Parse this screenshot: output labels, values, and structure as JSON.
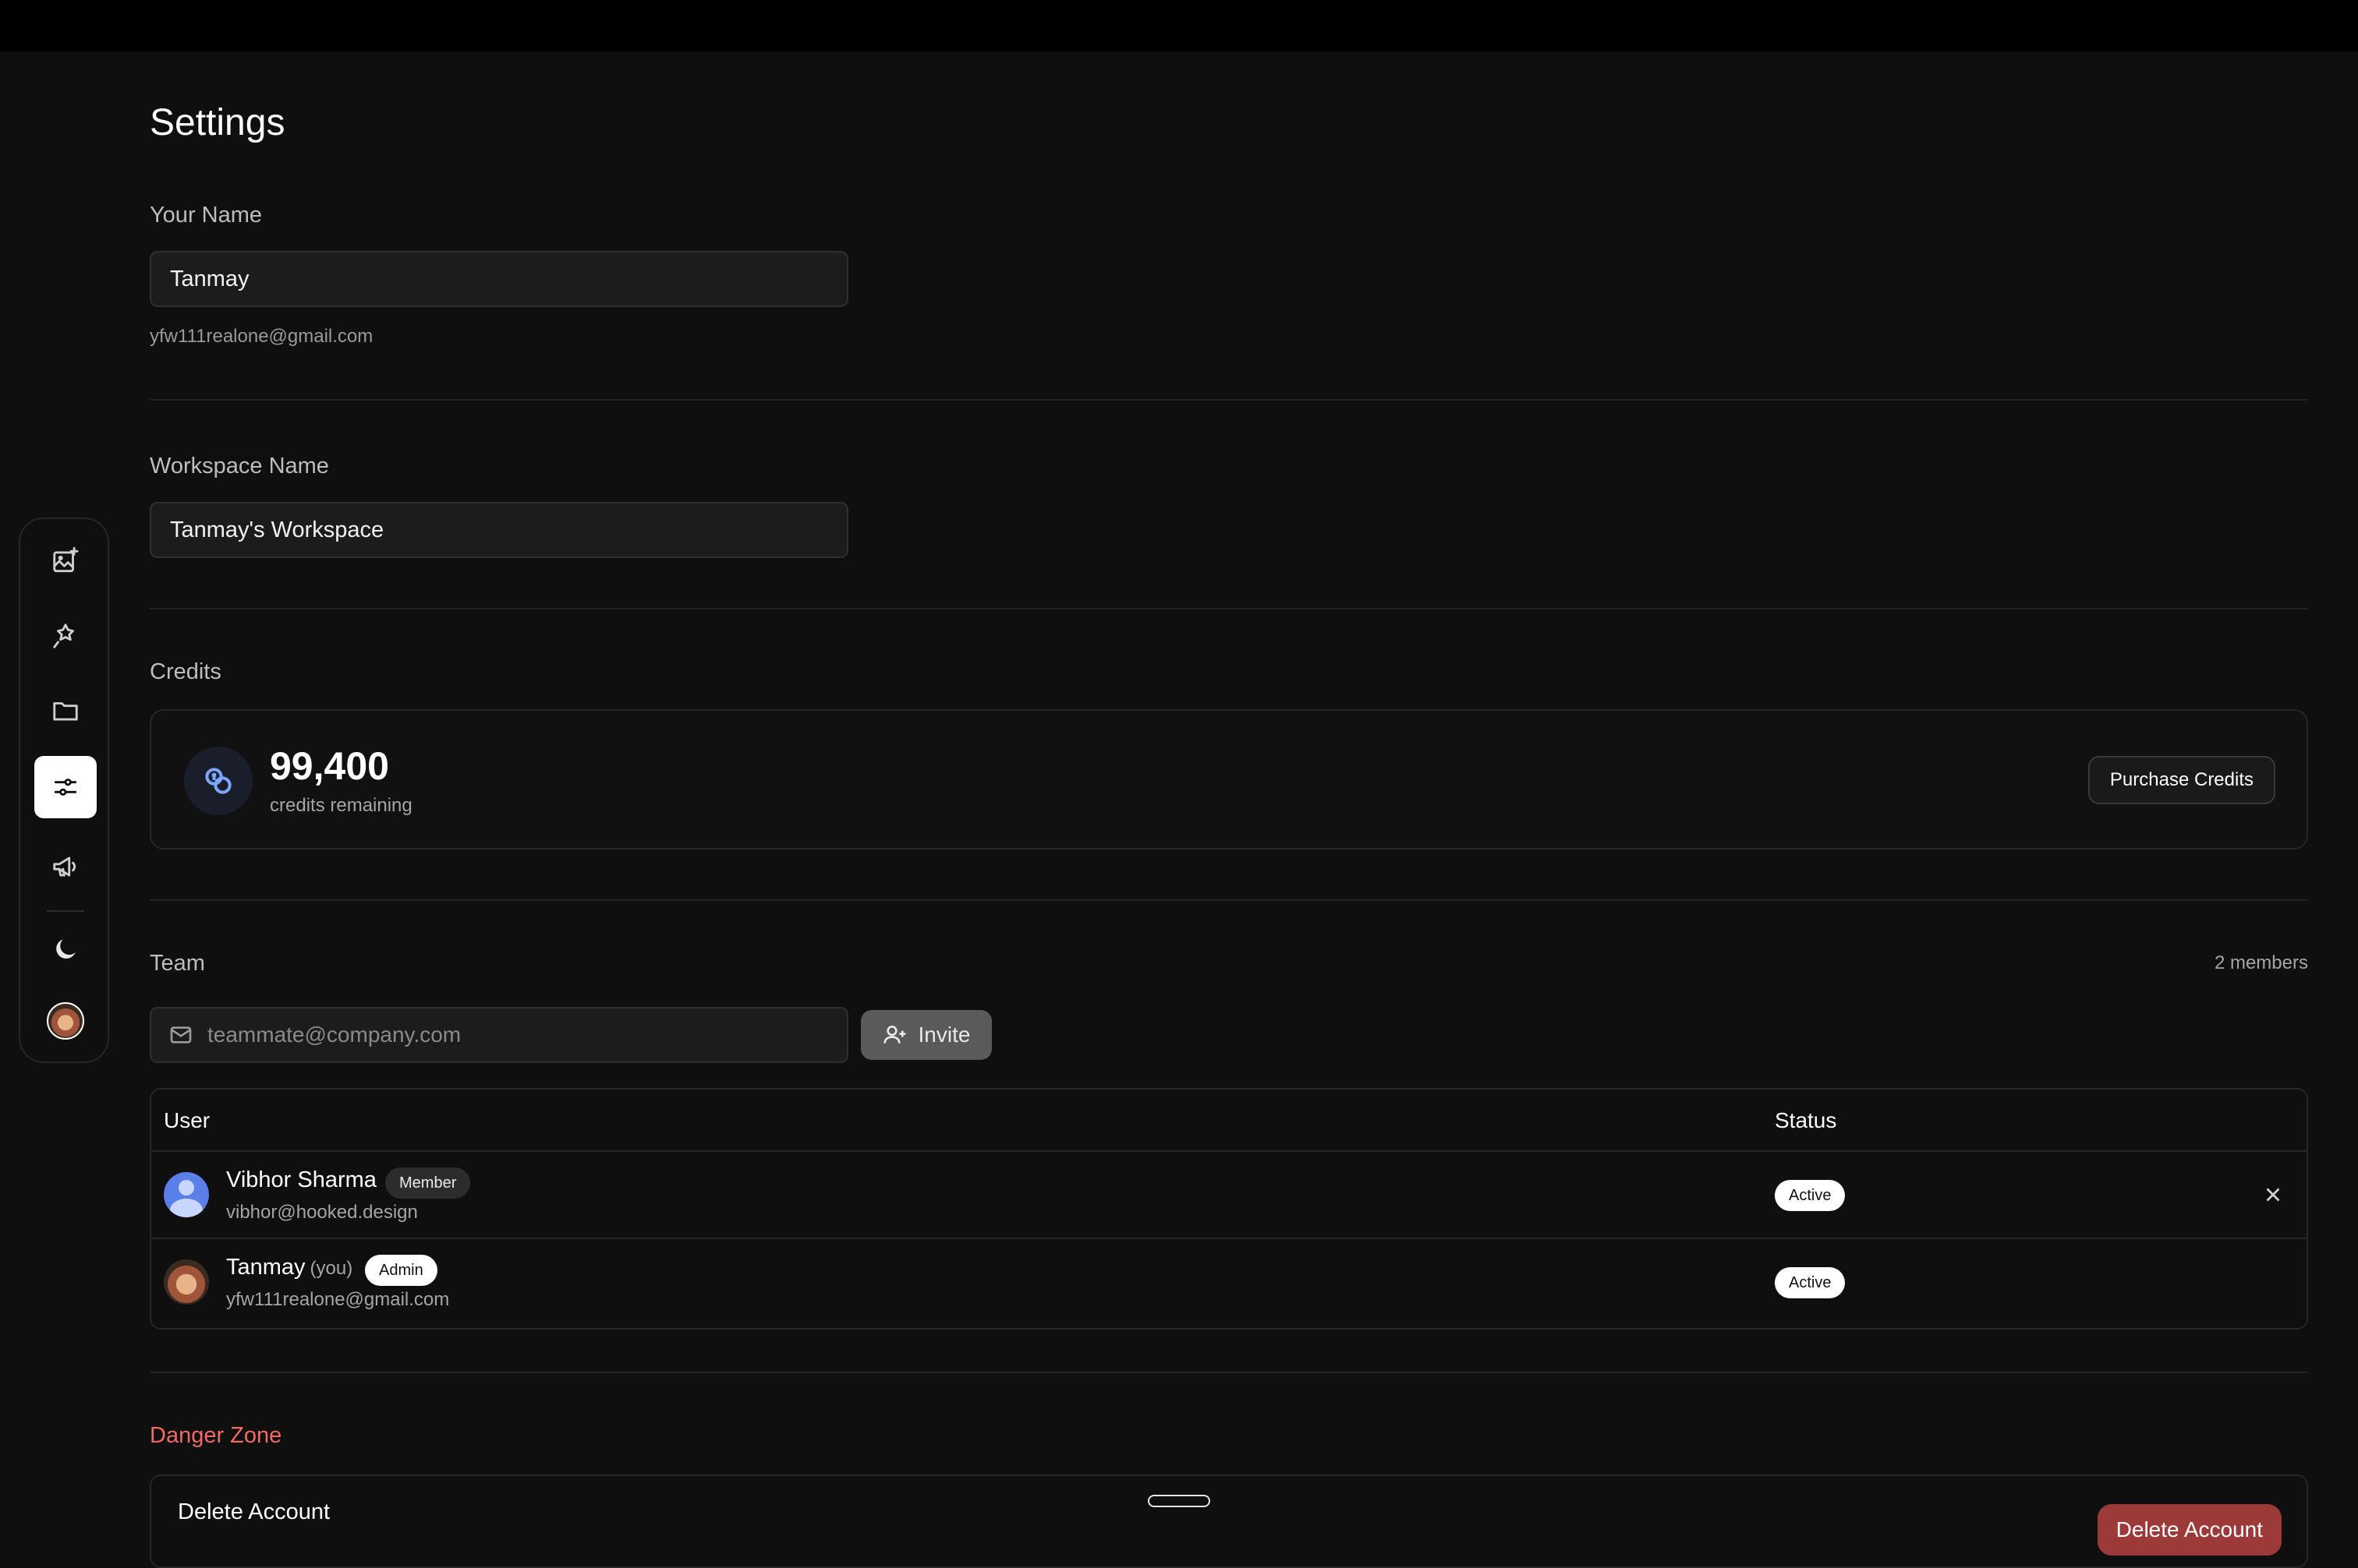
{
  "page": {
    "title": "Settings"
  },
  "profile": {
    "name_label": "Your Name",
    "name_value": "Tanmay",
    "email": "yfw111realone@gmail.com"
  },
  "workspace": {
    "label": "Workspace Name",
    "value": "Tanmay's Workspace"
  },
  "credits": {
    "label": "Credits",
    "amount": "99,400",
    "caption": "credits remaining",
    "purchase_label": "Purchase Credits",
    "icon": "coins-icon"
  },
  "team": {
    "label": "Team",
    "members_count": "2 members",
    "invite_placeholder": "teammate@company.com",
    "invite_label": "Invite",
    "columns": {
      "user": "User",
      "status": "Status"
    },
    "members": [
      {
        "name": "Vibhor Sharma",
        "you": "",
        "role": "Member",
        "email": "vibhor@hooked.design",
        "status": "Active"
      },
      {
        "name": "Tanmay",
        "you": "(you)",
        "role": "Admin",
        "email": "yfw111realone@gmail.com",
        "status": "Active"
      }
    ]
  },
  "danger": {
    "label": "Danger Zone",
    "item_label": "Delete Account",
    "button_label": "Delete Account"
  },
  "sidebar": {
    "items": [
      {
        "icon": "image-sparkle-icon"
      },
      {
        "icon": "magic-wand-icon"
      },
      {
        "icon": "folder-icon"
      },
      {
        "icon": "settings-sliders-icon",
        "active": true
      },
      {
        "icon": "megaphone-icon"
      },
      {
        "icon": "moon-icon"
      },
      {
        "icon": "avatar"
      }
    ]
  },
  "colors": {
    "background": "#0f0f10",
    "accent_blue": "#7ea6ff",
    "danger": "#f26a66",
    "danger_button": "#9b3a38"
  }
}
